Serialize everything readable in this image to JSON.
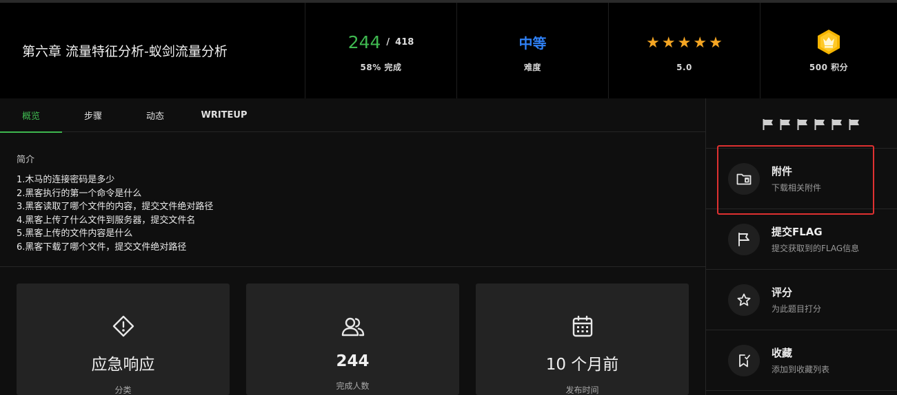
{
  "header": {
    "title": "第六章 流量特征分析-蚁剑流量分析",
    "progress": {
      "done": "244",
      "separator": "/",
      "total": "418",
      "label": "58% 完成",
      "percent": 58
    },
    "difficulty": {
      "value": "中等",
      "label": "难度",
      "color": "#2f81f7"
    },
    "rating": {
      "stars": 5,
      "value": "5.0"
    },
    "points": {
      "label": "500 积分",
      "icon": "crown-badge-icon",
      "icon_color": "#f5b400"
    }
  },
  "tabs": [
    {
      "label": "概览",
      "active": true
    },
    {
      "label": "步骤",
      "active": false
    },
    {
      "label": "动态",
      "active": false
    },
    {
      "label": "WRITEUP",
      "active": false
    }
  ],
  "intro": {
    "label": "简介",
    "lines": [
      "1.木马的连接密码是多少",
      "2.黑客执行的第一个命令是什么",
      "3.黑客读取了哪个文件的内容，提交文件绝对路径",
      "4.黑客上传了什么文件到服务器，提交文件名",
      "5.黑客上传的文件内容是什么",
      "6.黑客下载了哪个文件，提交文件绝对路径"
    ]
  },
  "cards": [
    {
      "icon": "warning-diamond-icon",
      "value": "应急响应",
      "label": "分类"
    },
    {
      "icon": "users-icon",
      "value": "244",
      "label": "完成人数"
    },
    {
      "icon": "calendar-icon",
      "value": "10 个月前",
      "label": "发布时间"
    }
  ],
  "sidebar": {
    "flag_count": 6,
    "items": [
      {
        "icon": "folder-icon",
        "title": "附件",
        "subtitle": "下载相关附件"
      },
      {
        "icon": "flag-icon",
        "title": "提交FLAG",
        "subtitle": "提交获取到的FLAG信息"
      },
      {
        "icon": "star-icon",
        "title": "评分",
        "subtitle": "为此题目打分"
      },
      {
        "icon": "bookmark-icon",
        "title": "收藏",
        "subtitle": "添加到收藏列表"
      }
    ]
  },
  "colors": {
    "accent": "#3fb950",
    "highlight": "#e03131",
    "star": "#f5a623"
  }
}
